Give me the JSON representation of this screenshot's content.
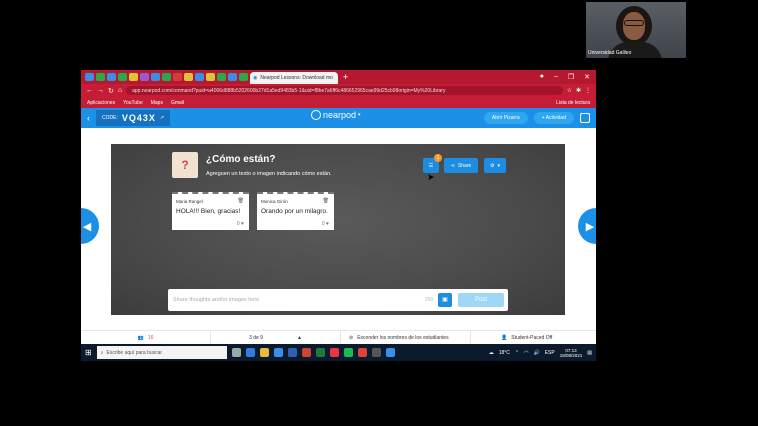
{
  "webcam": {
    "participant_name": "Universidad Galileo"
  },
  "browser": {
    "active_tab_title": "Nearpod Lessons: Download mo",
    "url": "app.nearpod.com/conmand?puid=a4006d888b5202600b27d1a5ed9483b5-1&uid=f8be7a6ff6c486652965cae99d25cb98origin=My%20Library",
    "bookmarks": [
      "Aplicaciones",
      "YouTube",
      "Maps",
      "Gmail"
    ],
    "reading_list": "Lista de lectura"
  },
  "nearpod": {
    "code_label": "CODE:",
    "code": "VQ43X",
    "logo_text": "nearpod",
    "open_board": "Abrir Pizarra",
    "add_activity": "+ Actividad"
  },
  "activity": {
    "title": "¿Cómo están?",
    "subtitle": "Agreguen un texto o imagen indicando cómo están.",
    "notification_count": "1",
    "share_label": "Share",
    "notes": [
      {
        "author": "Maria Rangel",
        "text": "HOLA!!! Bien, gracias!",
        "likes": "0"
      },
      {
        "author": "Monica Girón",
        "text": "Orando por un milagro.",
        "likes": "0"
      }
    ],
    "input_placeholder": "Share thoughts and/or images here",
    "char_count": "250",
    "post_label": "Post"
  },
  "footer": {
    "students": "16",
    "slide_position": "3 de 9",
    "hide_names": "Esconder los nombres de los estudiantes",
    "student_paced": "Student-Paced Off"
  },
  "taskbar": {
    "search_placeholder": "Escribe aquí para buscar",
    "temperature": "18°C",
    "language": "ESP",
    "time": "07:13",
    "date": "18/08/2021"
  }
}
